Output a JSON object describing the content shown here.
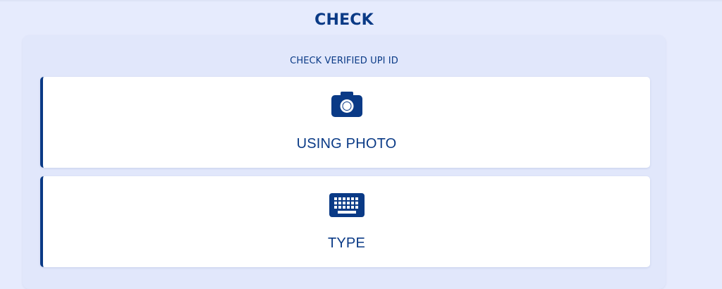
{
  "header": {
    "title": "CHECK"
  },
  "panel": {
    "subtitle": "CHECK VERIFIED UPI ID",
    "options": [
      {
        "label": "USING PHOTO",
        "icon": "camera-icon"
      },
      {
        "label": "TYPE",
        "icon": "keyboard-icon"
      }
    ]
  },
  "colors": {
    "page_background": "#e6ebfd",
    "panel_background": "#e1e7fb",
    "card_background": "#ffffff",
    "accent": "#0a3a86"
  }
}
